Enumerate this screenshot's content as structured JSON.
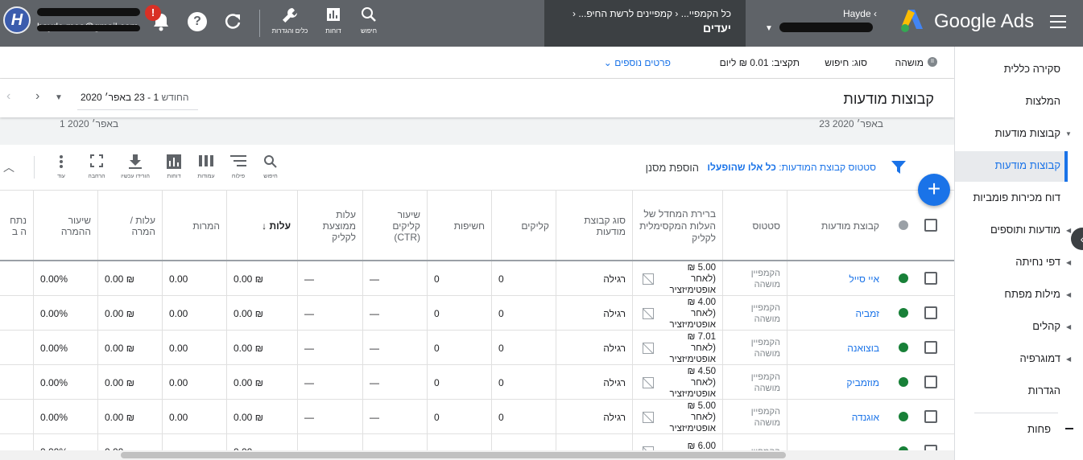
{
  "topbar": {
    "app_name": "Google Ads",
    "account_name": "Hayde",
    "breadcrumb_campaign": "כל הקמפיי...",
    "breadcrumb_sub": "קמפיינים לרשת החיפ...",
    "breadcrumb_page": "יעדים",
    "search_label": "חיפוש",
    "reports_label": "דוחות",
    "tools_label": "כלים והגדרות",
    "alert_count": "!",
    "user_email": "hayde.mes@gmail.com",
    "avatar_letter": "H"
  },
  "statusbar": {
    "status_label": "מושהה",
    "type_label": "סוג: חיפוש",
    "budget_label": "תקציב: 0.01 ₪ ליום",
    "more_details": "פרטים נוספים"
  },
  "header": {
    "title": "קבוצות מודעות",
    "period_label": "החודש",
    "date_range": "1 - 23 באפר׳ 2020",
    "date_end": "23 באפר׳ 2020",
    "date_start": "1 באפר׳ 2020"
  },
  "sidenav": {
    "items": [
      {
        "label": "סקירה כללית"
      },
      {
        "label": "המלצות"
      },
      {
        "label": "קבוצות מודעות"
      },
      {
        "label": "קבוצות מודעות"
      },
      {
        "label": "דוח מכירות פומביות"
      },
      {
        "label": "מודעות ותוספים"
      },
      {
        "label": "דפי נחיתה"
      },
      {
        "label": "מילות מפתח"
      },
      {
        "label": "קהלים"
      },
      {
        "label": "דמוגרפיה"
      },
      {
        "label": "הגדרות"
      },
      {
        "label": "פחות"
      }
    ]
  },
  "filterbar": {
    "status_filter_prefix": "סטטוס קבוצת המודעות:",
    "status_filter_value": "כל אלו שהופעלו",
    "add_filter": "הוספת מסנן",
    "tools": [
      {
        "label": "חיפוש",
        "icon": "search-icon"
      },
      {
        "label": "פילוח",
        "icon": "segment-icon"
      },
      {
        "label": "עמודות",
        "icon": "columns-icon"
      },
      {
        "label": "דוחות",
        "icon": "reports-icon"
      },
      {
        "label": "הורידו עכשיו",
        "icon": "download-icon"
      },
      {
        "label": "הרחבה",
        "icon": "expand-icon"
      },
      {
        "label": "עוד",
        "icon": "more-icon"
      }
    ]
  },
  "table": {
    "headers": {
      "adgroup": "קבוצת מודעות",
      "status": "סטטוס",
      "maxcpc": "ברירת המחדל של העלות המקסימלית לקליק",
      "type": "סוג קבוצת מודעות",
      "clicks": "קליקים",
      "impressions": "חשיפות",
      "ctr": "שיעור קליקים (CTR)",
      "avgcpc": "עלות ממוצעת לקליק",
      "cost": "עלות",
      "conversions": "המרות",
      "cost_conv": "עלות / המרה",
      "conv_rate": "שיעור ההמרה",
      "more": "נתח ה ב"
    },
    "rows": [
      {
        "name": "איי סייל",
        "status": "הקמפיין מושהה",
        "bid": "5.00 ₪",
        "bid_note": "(לאחר אופטימיזציר",
        "type": "רגילה",
        "clicks": "0",
        "impr": "0",
        "ctr": "—",
        "avgcpc": "—",
        "cost": "0.00 ₪",
        "conv": "0.00",
        "costconv": "0.00 ₪",
        "convrate": "0.00%"
      },
      {
        "name": "זמביה",
        "status": "הקמפיין מושהה",
        "bid": "4.00 ₪",
        "bid_note": "(לאחר אופטימיזציר",
        "type": "רגילה",
        "clicks": "0",
        "impr": "0",
        "ctr": "—",
        "avgcpc": "—",
        "cost": "0.00 ₪",
        "conv": "0.00",
        "costconv": "0.00 ₪",
        "convrate": "0.00%"
      },
      {
        "name": "בוצואנה",
        "status": "הקמפיין מושהה",
        "bid": "7.01 ₪",
        "bid_note": "(לאחר אופטימיזציר",
        "type": "רגילה",
        "clicks": "0",
        "impr": "0",
        "ctr": "—",
        "avgcpc": "—",
        "cost": "0.00 ₪",
        "conv": "0.00",
        "costconv": "0.00 ₪",
        "convrate": "0.00%"
      },
      {
        "name": "מוזמביק",
        "status": "הקמפיין מושהה",
        "bid": "4.50 ₪",
        "bid_note": "(לאחר אופטימיזציר",
        "type": "רגילה",
        "clicks": "0",
        "impr": "0",
        "ctr": "—",
        "avgcpc": "—",
        "cost": "0.00 ₪",
        "conv": "0.00",
        "costconv": "0.00 ₪",
        "convrate": "0.00%"
      },
      {
        "name": "אוגנדה",
        "status": "הקמפיין מושהה",
        "bid": "5.00 ₪",
        "bid_note": "(לאחר אופטימיזציר",
        "type": "רגילה",
        "clicks": "0",
        "impr": "0",
        "ctr": "—",
        "avgcpc": "—",
        "cost": "0.00 ₪",
        "conv": "0.00",
        "costconv": "0.00 ₪",
        "convrate": "0.00%"
      },
      {
        "name": "",
        "status": "הקמפיין",
        "bid": "6.00 ₪",
        "bid_note": "(לאחר",
        "type": "",
        "clicks": "",
        "impr": "",
        "ctr": "",
        "avgcpc": "",
        "cost": "0.00",
        "conv": "",
        "costconv": "0.00",
        "convrate": "0.00%"
      }
    ]
  }
}
